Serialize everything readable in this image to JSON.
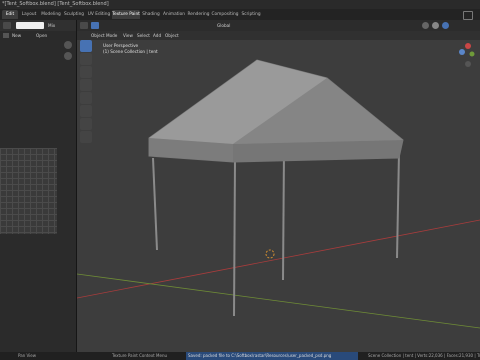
{
  "title_bar": {
    "text": "*[Tent_Softbox.blend] [Tent_Softbox.blend]"
  },
  "workspace_tabs": [
    {
      "label": "Edit",
      "active": true
    },
    {
      "label": "Layout",
      "active": false
    },
    {
      "label": "Modeling",
      "active": false
    },
    {
      "label": "Sculpting",
      "active": false
    },
    {
      "label": "UV Editing",
      "active": false
    },
    {
      "label": "Texture Paint",
      "active": true
    },
    {
      "label": "Shading",
      "active": false
    },
    {
      "label": "Animation",
      "active": false
    },
    {
      "label": "Rendering",
      "active": false
    },
    {
      "label": "Compositing",
      "active": false
    },
    {
      "label": "Scripting",
      "active": false
    }
  ],
  "image_editor": {
    "new_label": "New",
    "open_label": "Open",
    "mode_label": "Mix"
  },
  "viewport": {
    "mode_label": "Object Mode",
    "menu": [
      "View",
      "Select",
      "Add",
      "Object"
    ],
    "transform_label": "Global",
    "overlay_line1": "User Perspective",
    "overlay_line2": "(1) Scene Collection | tent",
    "options_label": "Options"
  },
  "status_bar": {
    "left": "Pan View",
    "middle": "Texture Paint Context Menu",
    "info": "Saved: packed file to C:\\Softbox\\rastar\\Resources\\user_packed_psd.png",
    "right": "Scene Collection | tent | Verts:22,036 | Faces:21,930 | Tris:43,6"
  },
  "colors": {
    "viewport_bg": "#3d3d3d",
    "accent_blue": "#4772b3",
    "x_axis": "#b04040",
    "y_axis": "#7a9a3a",
    "cursor": "#d79030"
  }
}
